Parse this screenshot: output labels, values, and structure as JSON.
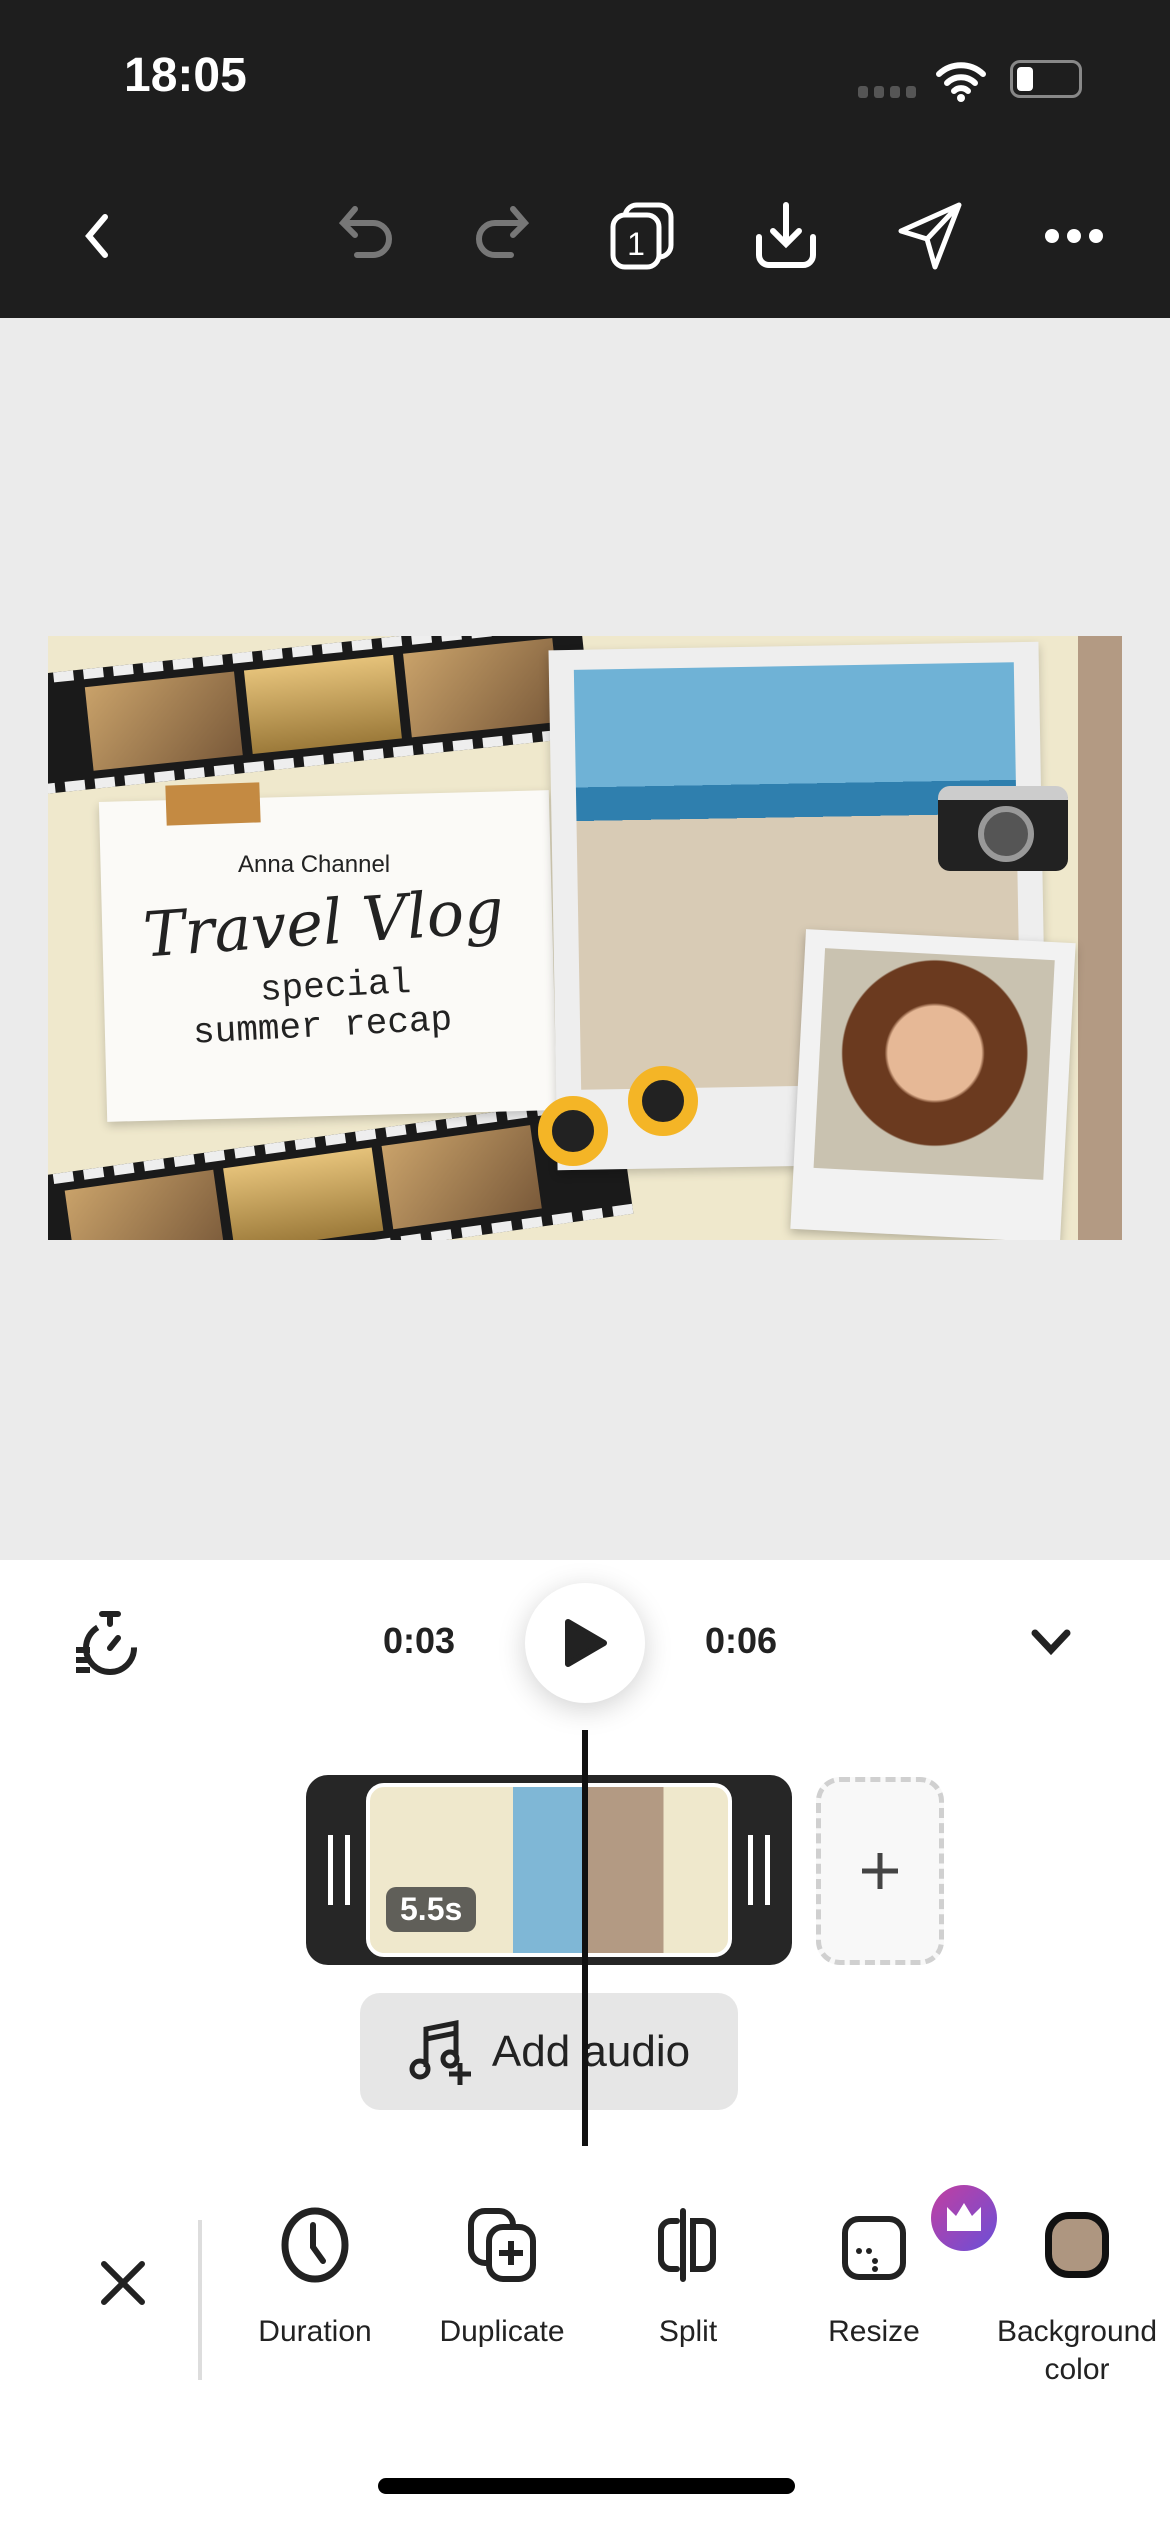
{
  "status_bar": {
    "time": "18:05"
  },
  "top_toolbar": {
    "icons": [
      "back-chevron",
      "undo",
      "redo",
      "pages",
      "download",
      "share",
      "more"
    ],
    "pages_count": "1"
  },
  "design": {
    "channel": "Anna Channel",
    "title": "Travel Vlog",
    "subtitle_1": "special",
    "subtitle_2": "summer recap",
    "background_color": "#efe8cc"
  },
  "playback": {
    "current_time": "0:03",
    "total_time": "0:06"
  },
  "timeline": {
    "clip_duration": "5.5s",
    "add_audio_label": "Add audio"
  },
  "tools": [
    {
      "label": "Duration",
      "icon": "clock"
    },
    {
      "label": "Duplicate",
      "icon": "duplicate"
    },
    {
      "label": "Split",
      "icon": "split"
    },
    {
      "label": "Resize",
      "icon": "resize",
      "premium": true
    },
    {
      "label": "Background",
      "label_2": "color",
      "icon": "color-swatch",
      "color": "#ae9680"
    }
  ],
  "colors": {
    "premium_badge": "#b04ac0"
  }
}
